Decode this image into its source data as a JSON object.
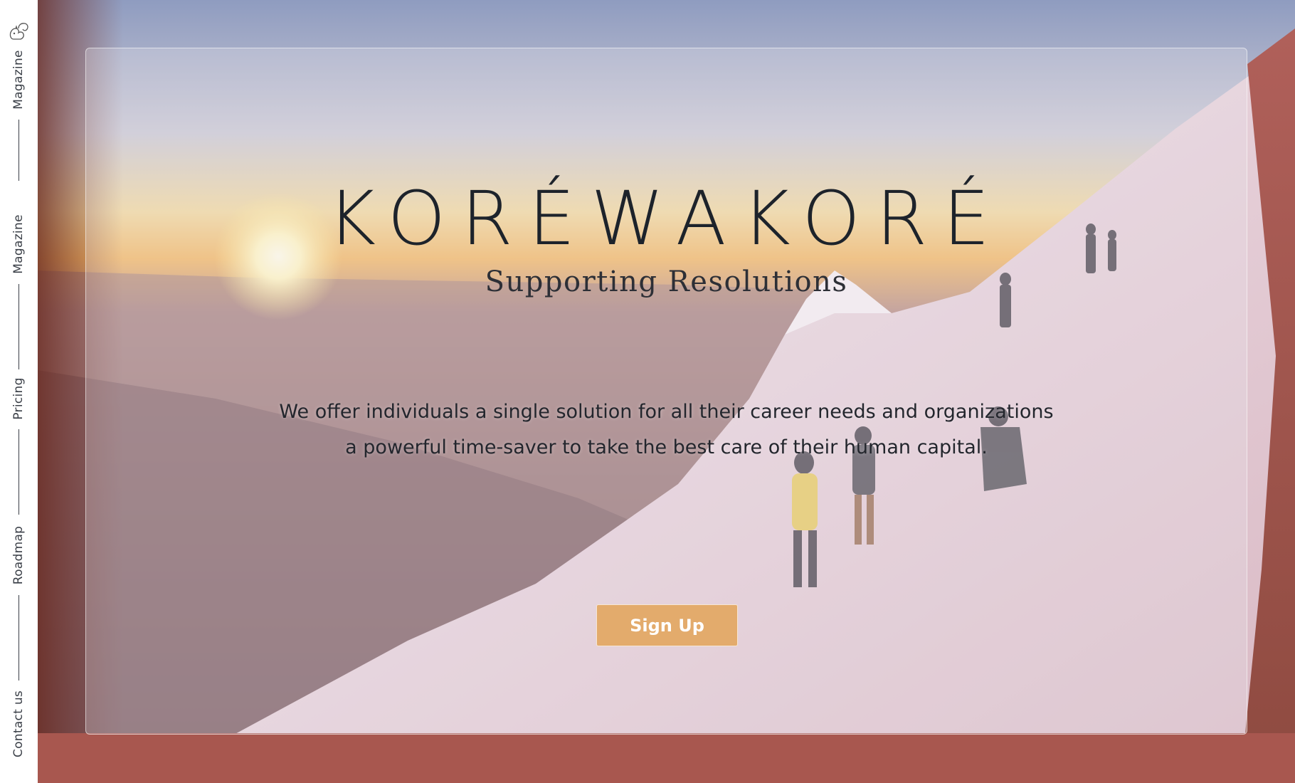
{
  "sidebar": {
    "logo_icon": "squirrel-logo-icon",
    "items": [
      {
        "label": "Magazine"
      },
      {
        "label": "Magazine"
      },
      {
        "label": "Pricing"
      },
      {
        "label": "Roadmap"
      },
      {
        "label": "Contact us"
      }
    ]
  },
  "hero": {
    "brand": "KORÉWAKORÉ",
    "subtitle": "Supporting Resolutions",
    "description": "We offer individuals a single solution for all their career needs and organizations a powerful time-saver to take the best care of their human capital.",
    "cta_label": "Sign Up"
  },
  "colors": {
    "sidebar_bg": "#ffffff",
    "cta": "#e3ab6c",
    "text_dark": "#1d232b"
  }
}
